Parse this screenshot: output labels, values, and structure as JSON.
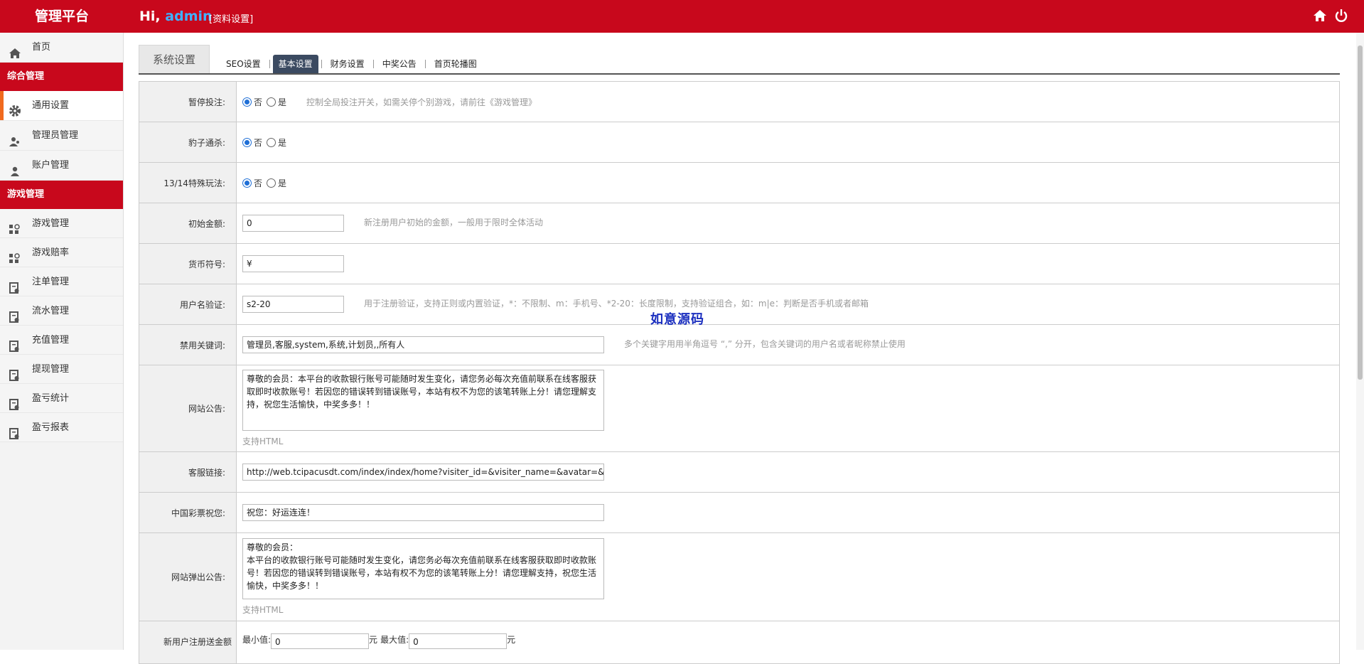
{
  "header": {
    "brand": "管理平台",
    "greeting": "Hi,",
    "username": "admin",
    "profile_link": "[资料设置]"
  },
  "sidebar": {
    "home": "首页",
    "group1": "综合管理",
    "group1_items": [
      "通用设置",
      "管理员管理",
      "账户管理"
    ],
    "group2": "游戏管理",
    "group2_items": [
      "游戏管理",
      "游戏赔率",
      "注单管理",
      "流水管理",
      "充值管理",
      "提现管理",
      "盈亏统计",
      "盈亏报表"
    ]
  },
  "tabs": {
    "main": "系统设置",
    "sub": [
      "SEO设置",
      "基本设置",
      "财务设置",
      "中奖公告",
      "首页轮播图"
    ]
  },
  "form": {
    "pause_label": "暂停投注:",
    "no": "否",
    "yes": "是",
    "pause_hint": "控制全局投注开关，如需关停个别游戏，请前往《游戏管理》",
    "leopard_label": "豹子通杀:",
    "special_label": "13/14特殊玩法:",
    "initial_label": "初始金额:",
    "initial_value": "0",
    "initial_hint": "新注册用户初始的金额，一般用于限时全体活动",
    "currency_label": "货币符号:",
    "currency_value": "¥",
    "username_label": "用户名验证:",
    "username_value": "s2-20",
    "username_hint": "用于注册验证，支持正则或内置验证，*：不限制、m：手机号、*2-20：长度限制，支持验证组合，如：m|e：判断是否手机或者邮箱",
    "banned_label": "禁用关键词:",
    "banned_value": "管理员,客服,system,系统,计划员,,所有人",
    "banned_hint": "多个关键字用用半角逗号 “,” 分开，包含关键词的用户名或者昵称禁止使用",
    "notice_label": "网站公告:",
    "notice_value": "尊敬的会员：本平台的收款银行账号可能随时发生变化，请您务必每次充值前联系在线客服获取即时收款账号！若因您的错误转到错误账号，本站有权不为您的该笔转账上分！请您理解支持，祝您生活愉快，中奖多多！！",
    "html_hint": "支持HTML",
    "service_label": "客服链接:",
    "service_value": "http://web.tcipacusdt.com/index/index/home?visiter_id=&visiter_name=&avatar=&bus",
    "lottery_label": "中国彩票祝您:",
    "lottery_value": "祝您：好运连连！",
    "popup_label": "网站弹出公告:",
    "popup_value": "尊敬的会员：\n本平台的收款银行账号可能随时发生变化，请您务必每次充值前联系在线客服获取即时收款账号！若因您的错误转到错误账号，本站有权不为您的该笔转账上分！请您理解支持，祝您生活愉快，中奖多多！！",
    "bonus_label": "新用户注册送金额",
    "min_label": "最小值:",
    "min_value": "0",
    "max_label": "最大值:",
    "max_value": "0",
    "unit": "元"
  },
  "watermark": "如意源码"
}
